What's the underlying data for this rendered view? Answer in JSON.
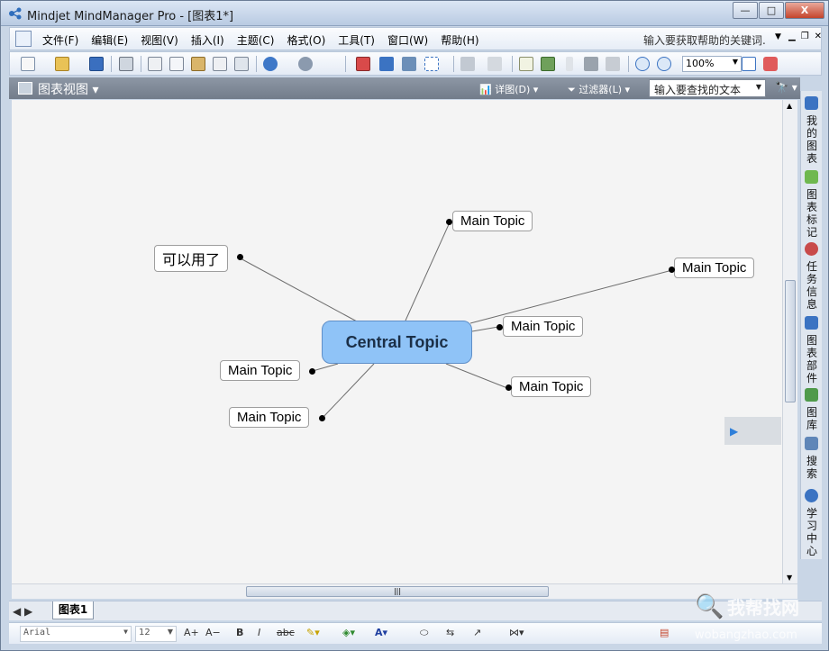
{
  "window": {
    "title": "Mindjet MindManager Pro - [图表1*]",
    "controls": {
      "minimize": "—",
      "maximize": "□",
      "close": "X"
    }
  },
  "menubar": {
    "items": [
      "文件(F)",
      "编辑(E)",
      "视图(V)",
      "插入(I)",
      "主题(C)",
      "格式(O)",
      "工具(T)",
      "窗口(W)",
      "帮助(H)"
    ],
    "help_placeholder": "输入要获取帮助的关键词."
  },
  "toolbar": {
    "zoom": "100%",
    "icons": [
      "new-icon",
      "open-icon",
      "save-icon",
      "print-icon",
      "cut-icon",
      "copy-icon",
      "paste-icon",
      "format-painter-icon",
      "spell-icon",
      "undo-icon",
      "redo-icon",
      "topic-icon",
      "relationship-icon",
      "callout-icon",
      "boundary-icon",
      "attach-icon",
      "hyperlink-icon",
      "notes-icon",
      "image-icon",
      "zoom-in-icon",
      "zoom-out-icon"
    ]
  },
  "view": {
    "title": "图表视图",
    "detail_label": "详图(D)",
    "filter_label": "过滤器(L)",
    "search_placeholder": "输入要查找的文本"
  },
  "map": {
    "central": "Central Topic",
    "topics": [
      "Main Topic",
      "Main Topic",
      "Main Topic",
      "Main Topic",
      "Main Topic",
      "Main Topic",
      "可以用了"
    ]
  },
  "taskpane": {
    "tabs": [
      "我的图表",
      "图表标记",
      "任务信息",
      "图表部件",
      "图库",
      "搜索",
      "学习中心"
    ]
  },
  "sheets": {
    "active": "图表1"
  },
  "format": {
    "font": "Arial",
    "size": "12"
  },
  "watermark": {
    "brand": "我帮找网",
    "url": "wobangzhao.com"
  }
}
